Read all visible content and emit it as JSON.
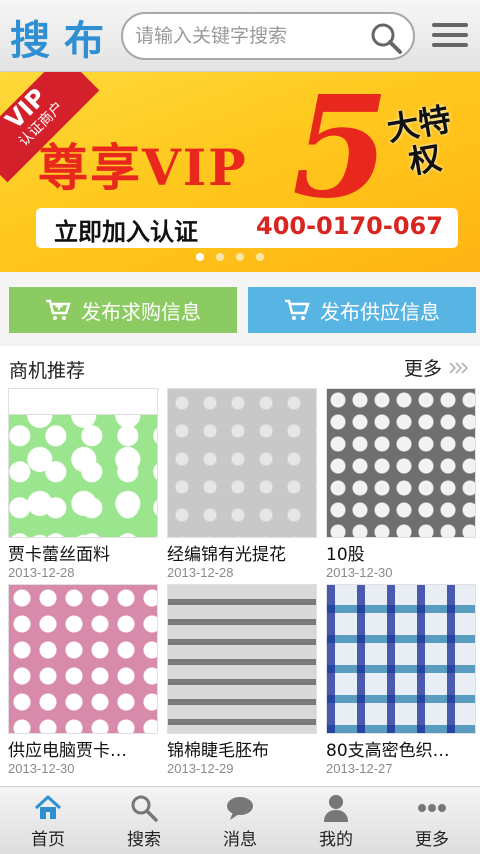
{
  "header": {
    "logo": "搜布",
    "search_placeholder": "请输入关键字搜索"
  },
  "banner": {
    "ribbon_vip": "VIP",
    "ribbon_text": "认证商户",
    "title": "尊享VIP",
    "big_number": "5",
    "side_text": "大特权",
    "join_text": "立即加入认证",
    "phone": "400-0170-067",
    "pages": 4,
    "active_page": 1
  },
  "actions": {
    "buy_label": "发布求购信息",
    "supply_label": "发布供应信息"
  },
  "recommend": {
    "title": "商机推荐",
    "more": "更多",
    "items": [
      {
        "name": "贾卡蕾丝面料",
        "date": "2013-12-28"
      },
      {
        "name": "经编锦有光提花",
        "date": "2013-12-28"
      },
      {
        "name": "10股",
        "date": "2013-12-30"
      },
      {
        "name": "供应电脑贾卡…",
        "date": "2013-12-30"
      },
      {
        "name": "锦棉睫毛胚布",
        "date": "2013-12-29"
      },
      {
        "name": "80支高密色织…",
        "date": "2013-12-27"
      }
    ]
  },
  "tabbar": {
    "home": "首页",
    "search": "搜索",
    "messages": "消息",
    "mine": "我的",
    "more": "更多",
    "active": "home"
  },
  "colors": {
    "accent_blue": "#2f8fd3",
    "buy_green": "#8ccb62",
    "supply_blue": "#58b5e3",
    "banner_red": "#e8281d"
  }
}
